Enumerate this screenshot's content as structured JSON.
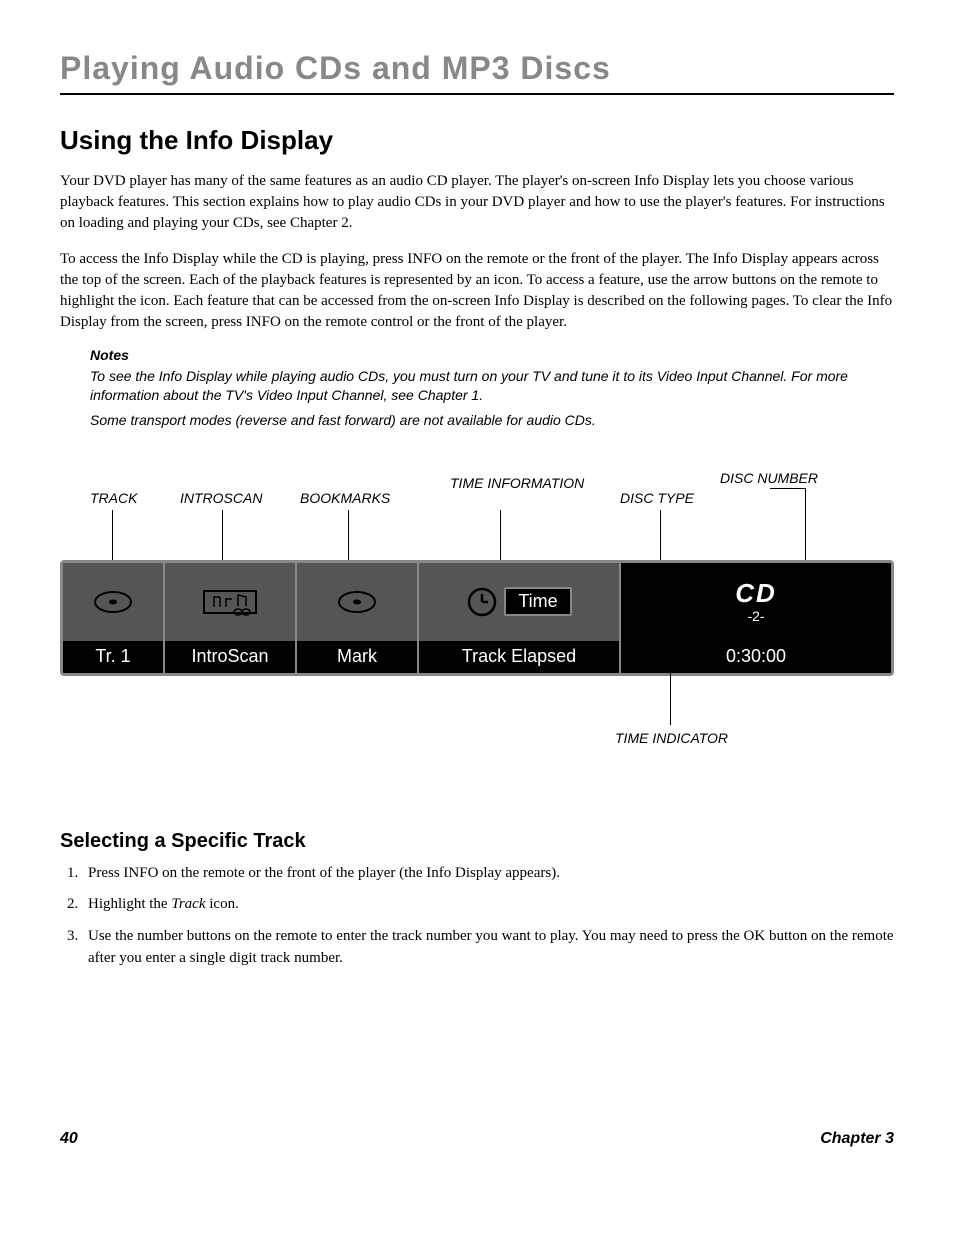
{
  "chapter_title": "Playing Audio CDs and MP3 Discs",
  "section_title": "Using the Info Display",
  "para1": "Your DVD player has many of the same features as an audio CD player. The player's on-screen Info Display lets you choose various playback features. This section explains how to play audio CDs in your DVD player and how to use the player's features. For instructions on loading and playing your CDs, see Chapter 2.",
  "para2": "To access the Info Display while the CD is playing, press INFO on the remote or the front of the player. The Info Display appears across the top of the screen. Each of the playback features is represented by an icon. To access a feature, use the arrow buttons on the remote to highlight the icon. Each feature that can be accessed from the on-screen Info Display is described on the following pages. To clear the Info Display from the screen, press INFO on the remote control or the front of the player.",
  "notes": {
    "heading": "Notes",
    "line1": "To see the Info Display while playing audio CDs, you must turn on your TV and tune it to its Video Input Channel. For more information about the TV's Video Input Channel,  see Chapter 1.",
    "line2": "Some transport modes (reverse and fast forward) are not available for audio CDs."
  },
  "diagram": {
    "labels": {
      "track": "TRACK",
      "introscan": "INTROSCAN",
      "bookmarks": "BOOKMARKS",
      "time_info": "TIME INFORMATION",
      "disc_type": "DISC TYPE",
      "disc_number": "DISC NUMBER",
      "time_indicator": "TIME INDICATOR"
    },
    "values": {
      "track": "Tr.  1",
      "introscan": "IntroScan",
      "mark": "Mark",
      "time_label": "Time",
      "time_mode": "Track Elapsed",
      "cd": "CD",
      "disc_num": "-2-",
      "elapsed": "0:30:00"
    }
  },
  "subsection_title": "Selecting a Specific Track",
  "steps": {
    "s1": "Press INFO on the remote or the front of the player (the Info Display appears).",
    "s2a": "Highlight the ",
    "s2b": "Track",
    "s2c": " icon.",
    "s3": "Use the number buttons on the remote to enter the track number you want to play. You may need to press the OK button on the remote after you enter a single digit track number."
  },
  "footer": {
    "page": "40",
    "chapter": "Chapter 3"
  }
}
